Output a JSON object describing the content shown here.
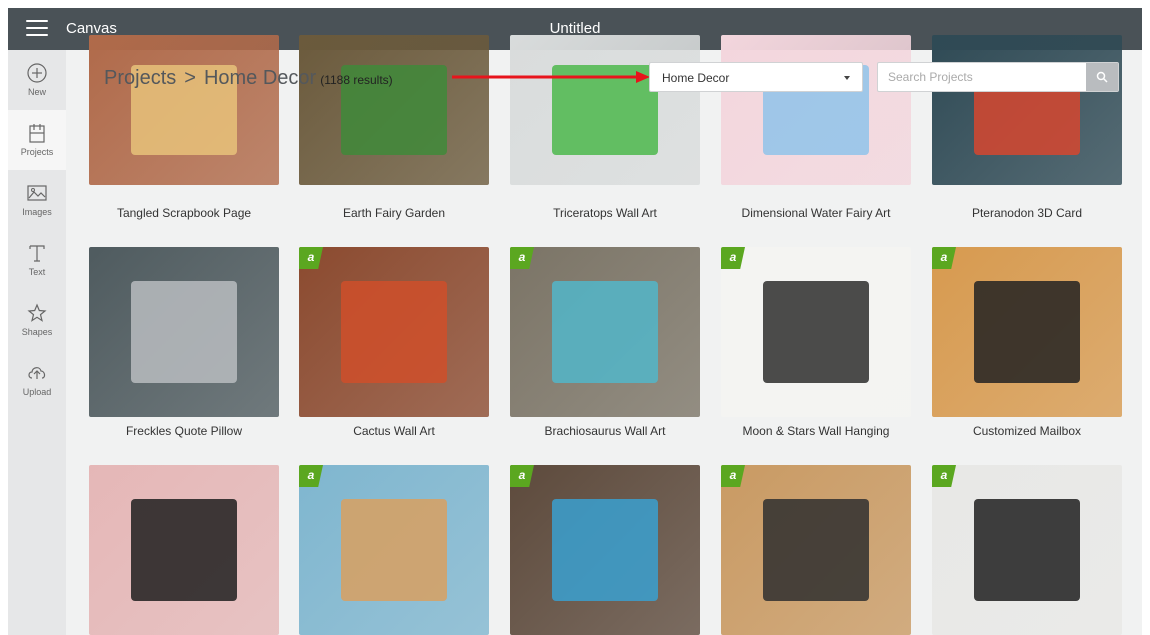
{
  "topbar": {
    "app_title": "Canvas",
    "doc_title": "Untitled"
  },
  "sidebar": {
    "items": [
      {
        "label": "New",
        "icon": "plus-circle-icon"
      },
      {
        "label": "Projects",
        "icon": "projects-icon"
      },
      {
        "label": "Images",
        "icon": "image-icon"
      },
      {
        "label": "Text",
        "icon": "text-icon"
      },
      {
        "label": "Shapes",
        "icon": "shapes-icon"
      },
      {
        "label": "Upload",
        "icon": "upload-icon"
      }
    ],
    "active": "Projects"
  },
  "breadcrumb": {
    "root": "Projects",
    "separator": ">",
    "current": "Home Decor",
    "count": "(1188 results)"
  },
  "category_select": {
    "value": "Home Decor"
  },
  "search": {
    "placeholder": "Search Projects",
    "value": ""
  },
  "colors": {
    "topbar": "#4a5257",
    "sidebar": "#e6e7e8",
    "badge": "#5ba720",
    "annotation_arrow": "#e8141c"
  },
  "projects": [
    {
      "title": "Tangled Scrapbook Page",
      "badge": false,
      "colors": [
        "#b06a4a",
        "#e8c27a"
      ]
    },
    {
      "title": "Earth Fairy Garden",
      "badge": false,
      "colors": [
        "#6b5a3c",
        "#3f8a3a"
      ]
    },
    {
      "title": "Triceratops Wall Art",
      "badge": false,
      "colors": [
        "#d9dcdc",
        "#4cb84c"
      ]
    },
    {
      "title": "Dimensional Water Fairy Art",
      "badge": false,
      "colors": [
        "#f3d6dd",
        "#8fc3ea"
      ]
    },
    {
      "title": "Pteranodon 3D Card",
      "badge": false,
      "colors": [
        "#2f4a55",
        "#d6472f"
      ]
    },
    {
      "title": "Freckles Quote Pillow",
      "badge": false,
      "colors": [
        "#4f5b5f",
        "#b9bcbf"
      ]
    },
    {
      "title": "Cactus Wall Art",
      "badge": true,
      "badge_label": "a",
      "colors": [
        "#8b4a2f",
        "#cf4f2a"
      ]
    },
    {
      "title": "Brachiosaurus Wall Art",
      "badge": true,
      "badge_label": "a",
      "colors": [
        "#7b7466",
        "#52b6c9"
      ]
    },
    {
      "title": "Moon & Stars Wall Hanging",
      "badge": true,
      "badge_label": "a",
      "colors": [
        "#f4f4f2",
        "#2d2d2d"
      ]
    },
    {
      "title": "Customized Mailbox",
      "badge": true,
      "badge_label": "a",
      "colors": [
        "#d79a4f",
        "#222222"
      ]
    },
    {
      "title": "",
      "badge": false,
      "colors": [
        "#e5b7b7",
        "#1f1f1f"
      ]
    },
    {
      "title": "",
      "badge": true,
      "badge_label": "a",
      "colors": [
        "#7fb6cf",
        "#d8a060"
      ]
    },
    {
      "title": "",
      "badge": true,
      "badge_label": "a",
      "colors": [
        "#5d4a3c",
        "#3aa0d0"
      ]
    },
    {
      "title": "",
      "badge": true,
      "badge_label": "a",
      "colors": [
        "#c99a63",
        "#2f2f2f"
      ]
    },
    {
      "title": "",
      "badge": true,
      "badge_label": "a",
      "colors": [
        "#e8e8e6",
        "#1f1f1f"
      ]
    }
  ]
}
